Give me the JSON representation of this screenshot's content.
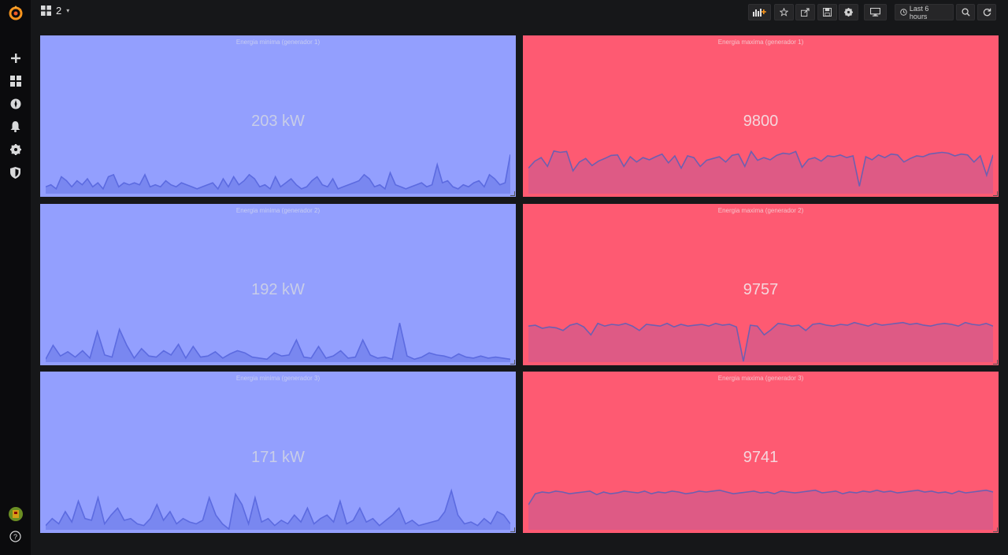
{
  "app": {
    "logo_icon": "grafana-logo-icon"
  },
  "header": {
    "dashboard_title": "2",
    "time_range_label": "Last 6 hours"
  },
  "sidemenu": {
    "items": [
      {
        "name": "create",
        "icon": "plus-icon"
      },
      {
        "name": "dashboards",
        "icon": "dashboards-icon"
      },
      {
        "name": "explore",
        "icon": "compass-icon"
      },
      {
        "name": "alerting",
        "icon": "bell-icon"
      },
      {
        "name": "configuration",
        "icon": "gear-icon"
      },
      {
        "name": "server-admin",
        "icon": "shield-icon"
      }
    ],
    "bottom": [
      {
        "name": "profile",
        "icon": "avatar-icon"
      },
      {
        "name": "help",
        "icon": "question-icon"
      }
    ]
  },
  "colors": {
    "blue_panel": "#939ffe",
    "blue_line": "#5c6be0",
    "red_panel": "#fe5a72",
    "red_line": "#6e5fb0",
    "red_fill": "#d85a88"
  },
  "panels": [
    {
      "title": "Energia minima (generador 1)",
      "value": "203 kW",
      "color": "blue",
      "spark": [
        3,
        4,
        2,
        8,
        6,
        3,
        6,
        4,
        7,
        3,
        5,
        2,
        8,
        9,
        3,
        5,
        4,
        5,
        4,
        9,
        3,
        4,
        3,
        6,
        4,
        3,
        5,
        4,
        3,
        2,
        3,
        4,
        5,
        2,
        7,
        3,
        8,
        4,
        6,
        9,
        7,
        3,
        4,
        2,
        8,
        3,
        5,
        7,
        4,
        2,
        3,
        6,
        8,
        4,
        3,
        7,
        2,
        3,
        4,
        5,
        6,
        9,
        7,
        3,
        4,
        2,
        10,
        4,
        3,
        2,
        3,
        4,
        5,
        3,
        4,
        14,
        5,
        6,
        3,
        2,
        4,
        3,
        5,
        6,
        3,
        9,
        7,
        4,
        5,
        19
      ]
    },
    {
      "title": "Energia maxima (generador 1)",
      "value": "9800",
      "color": "red",
      "spark": [
        56,
        72,
        80,
        60,
        95,
        92,
        94,
        50,
        70,
        78,
        62,
        72,
        78,
        85,
        86,
        60,
        82,
        70,
        80,
        75,
        82,
        88,
        68,
        84,
        56,
        84,
        80,
        60,
        74,
        78,
        82,
        70,
        85,
        88,
        60,
        94,
        74,
        80,
        75,
        85,
        90,
        88,
        94,
        58,
        76,
        80,
        72,
        84,
        82,
        86,
        80,
        84,
        15,
        82,
        75,
        86,
        80,
        88,
        86,
        70,
        78,
        84,
        82,
        88,
        90,
        92,
        90,
        84,
        88,
        86,
        70,
        84,
        40,
        86
      ]
    },
    {
      "title": "Energia minima (generador 2)",
      "value": "192 kW",
      "color": "blue",
      "spark": [
        2,
        15,
        5,
        9,
        4,
        10,
        3,
        28,
        6,
        4,
        30,
        15,
        3,
        12,
        5,
        4,
        10,
        6,
        16,
        3,
        14,
        4,
        5,
        9,
        3,
        7,
        10,
        8,
        4,
        3,
        2,
        8,
        5,
        6,
        20,
        4,
        3,
        14,
        3,
        5,
        10,
        3,
        4,
        20,
        6,
        3,
        4,
        2,
        36,
        5,
        2,
        4,
        8,
        6,
        5,
        3,
        7,
        4,
        3,
        5,
        3,
        4,
        3,
        2
      ]
    },
    {
      "title": "Energia maxima (generador 2)",
      "value": "9757",
      "color": "red",
      "spark": [
        80,
        82,
        75,
        78,
        76,
        70,
        82,
        86,
        78,
        60,
        86,
        80,
        84,
        82,
        86,
        80,
        70,
        84,
        82,
        80,
        86,
        78,
        84,
        80,
        82,
        84,
        80,
        86,
        82,
        84,
        78,
        0,
        82,
        80,
        60,
        72,
        86,
        84,
        80,
        82,
        70,
        84,
        86,
        82,
        80,
        84,
        82,
        88,
        84,
        80,
        86,
        82,
        84,
        86,
        88,
        84,
        86,
        82,
        80,
        84,
        86,
        84,
        80,
        88,
        84,
        82,
        86,
        80
      ]
    },
    {
      "title": "Energia minima (generador 3)",
      "value": "171 kW",
      "color": "blue",
      "spark": [
        2,
        6,
        3,
        10,
        4,
        16,
        6,
        5,
        18,
        3,
        8,
        12,
        5,
        6,
        3,
        2,
        6,
        14,
        5,
        10,
        3,
        6,
        4,
        3,
        5,
        18,
        8,
        3,
        0,
        20,
        14,
        3,
        18,
        4,
        6,
        2,
        5,
        3,
        8,
        4,
        12,
        3,
        6,
        8,
        4,
        16,
        3,
        5,
        12,
        4,
        6,
        2,
        5,
        8,
        12,
        3,
        5,
        2,
        3,
        4,
        5,
        10,
        22,
        8,
        3,
        4,
        2,
        6,
        3,
        10,
        8,
        3
      ]
    },
    {
      "title": "Energia maxima (generador 3)",
      "value": "9741",
      "color": "red",
      "spark": [
        55,
        80,
        84,
        82,
        86,
        84,
        80,
        82,
        84,
        86,
        78,
        84,
        80,
        82,
        86,
        84,
        82,
        86,
        80,
        84,
        82,
        86,
        84,
        80,
        82,
        86,
        84,
        86,
        88,
        84,
        80,
        82,
        84,
        86,
        82,
        84,
        80,
        86,
        84,
        82,
        84,
        86,
        88,
        82,
        84,
        86,
        80,
        84,
        82,
        86,
        84,
        88,
        84,
        86,
        82,
        84,
        86,
        88,
        84,
        86,
        82,
        84,
        80,
        86,
        82,
        84,
        86,
        88,
        84
      ]
    }
  ]
}
